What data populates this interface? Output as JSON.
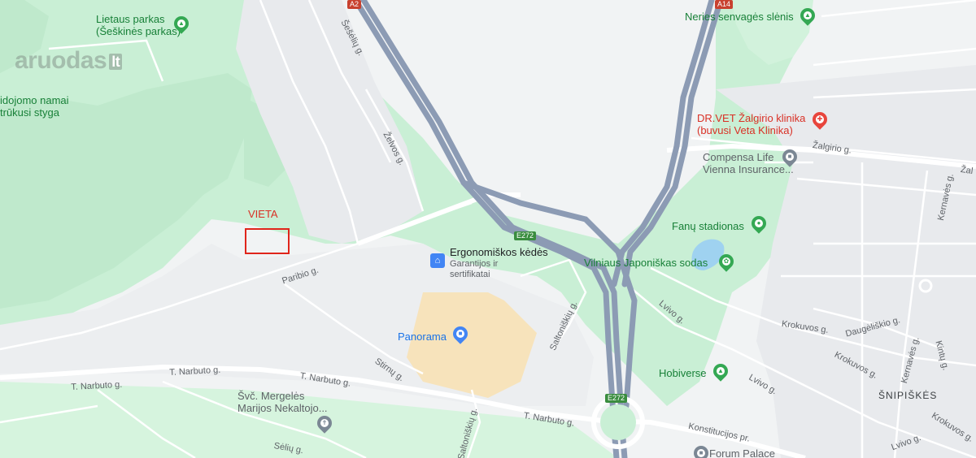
{
  "watermark": {
    "brand": "aruodas",
    "suffix": "lt"
  },
  "marker": {
    "label": "VIETA"
  },
  "parks": {
    "lietaus_1": "Lietaus parkas",
    "lietaus_2": "(Šeškinės parkas)",
    "neries": "Neries senvagės slėnis",
    "vidojomo_1": "idojomo namai",
    "vidojomo_2": "trūkusi styga"
  },
  "pois": {
    "drvet_1": "DR.VET Žalgirio klinika",
    "drvet_2": "(buvusi Veta Klinika)",
    "compensa_1": "Compensa Life",
    "compensa_2": "Vienna Insurance...",
    "fanu": "Fanų stadionas",
    "japonu": "Vilniaus Japoniškas sodas",
    "ergo_1": "Ergonomiškos kėdės",
    "ergo_2": "Garantijos ir",
    "ergo_3": "sertifikatai",
    "panorama": "Panorama",
    "hobiverse": "Hobiverse",
    "svc_1": "Švč. Mergelės",
    "svc_2": "Marijos Nekaltojo...",
    "forum": "Forum Palace"
  },
  "districts": {
    "snipiskes": "ŠNIPIŠKĖS"
  },
  "streets": {
    "sesiku": "Šešėlių g.",
    "zelvos": "Želvos g.",
    "paribio": "Paribio g.",
    "narbuto_1": "T. Narbuto g.",
    "narbuto_2": "T. Narbuto g.",
    "narbuto_3": "T. Narbuto g.",
    "stirnu": "Stirnų g.",
    "seliu": "Sėlių g.",
    "saltoniskiu_1": "Saltoniškių g.",
    "saltoniskiu_2": "Saltoniškių g.",
    "lvivo_1": "Lvivo g.",
    "lvivo_2": "Lvivo g.",
    "lvivo_3": "Lvivo g.",
    "krokuvos_1": "Krokuvos g.",
    "krokuvos_2": "Krokuvos g.",
    "krokuvos_3": "Krokuvos g.",
    "daugeliskio": "Daugėliškio g.",
    "kernaves_1": "Kernavės g.",
    "kernaves_2": "Kernavės g.",
    "kintu": "Kintų g.",
    "zalgirio": "Žalgirio g.",
    "zalg_edge": "Žal",
    "konstitucijos": "Konstitucijos pr."
  },
  "shields": {
    "a2": "A2",
    "a14": "A14",
    "e272_1": "E272",
    "e272_2": "E272"
  },
  "colors": {
    "background": "#f1f3f4",
    "park": "#c9efd5",
    "park_dark": "#bfe9cc",
    "highway": "#8c9bb4",
    "highway_edge": "#7b8aa4",
    "mall": "#f7e3bb",
    "marker": "#e0251b",
    "shield_green": "#3a8d3f",
    "shield_red": "#c8412f"
  },
  "icons": {
    "park": "tree-icon",
    "vet": "vet-clinic-icon",
    "office": "office-icon",
    "stadium": "stadium-icon",
    "garden": "garden-icon",
    "shop": "shopping-bag-icon",
    "church": "cross-icon",
    "museum": "museum-icon"
  }
}
